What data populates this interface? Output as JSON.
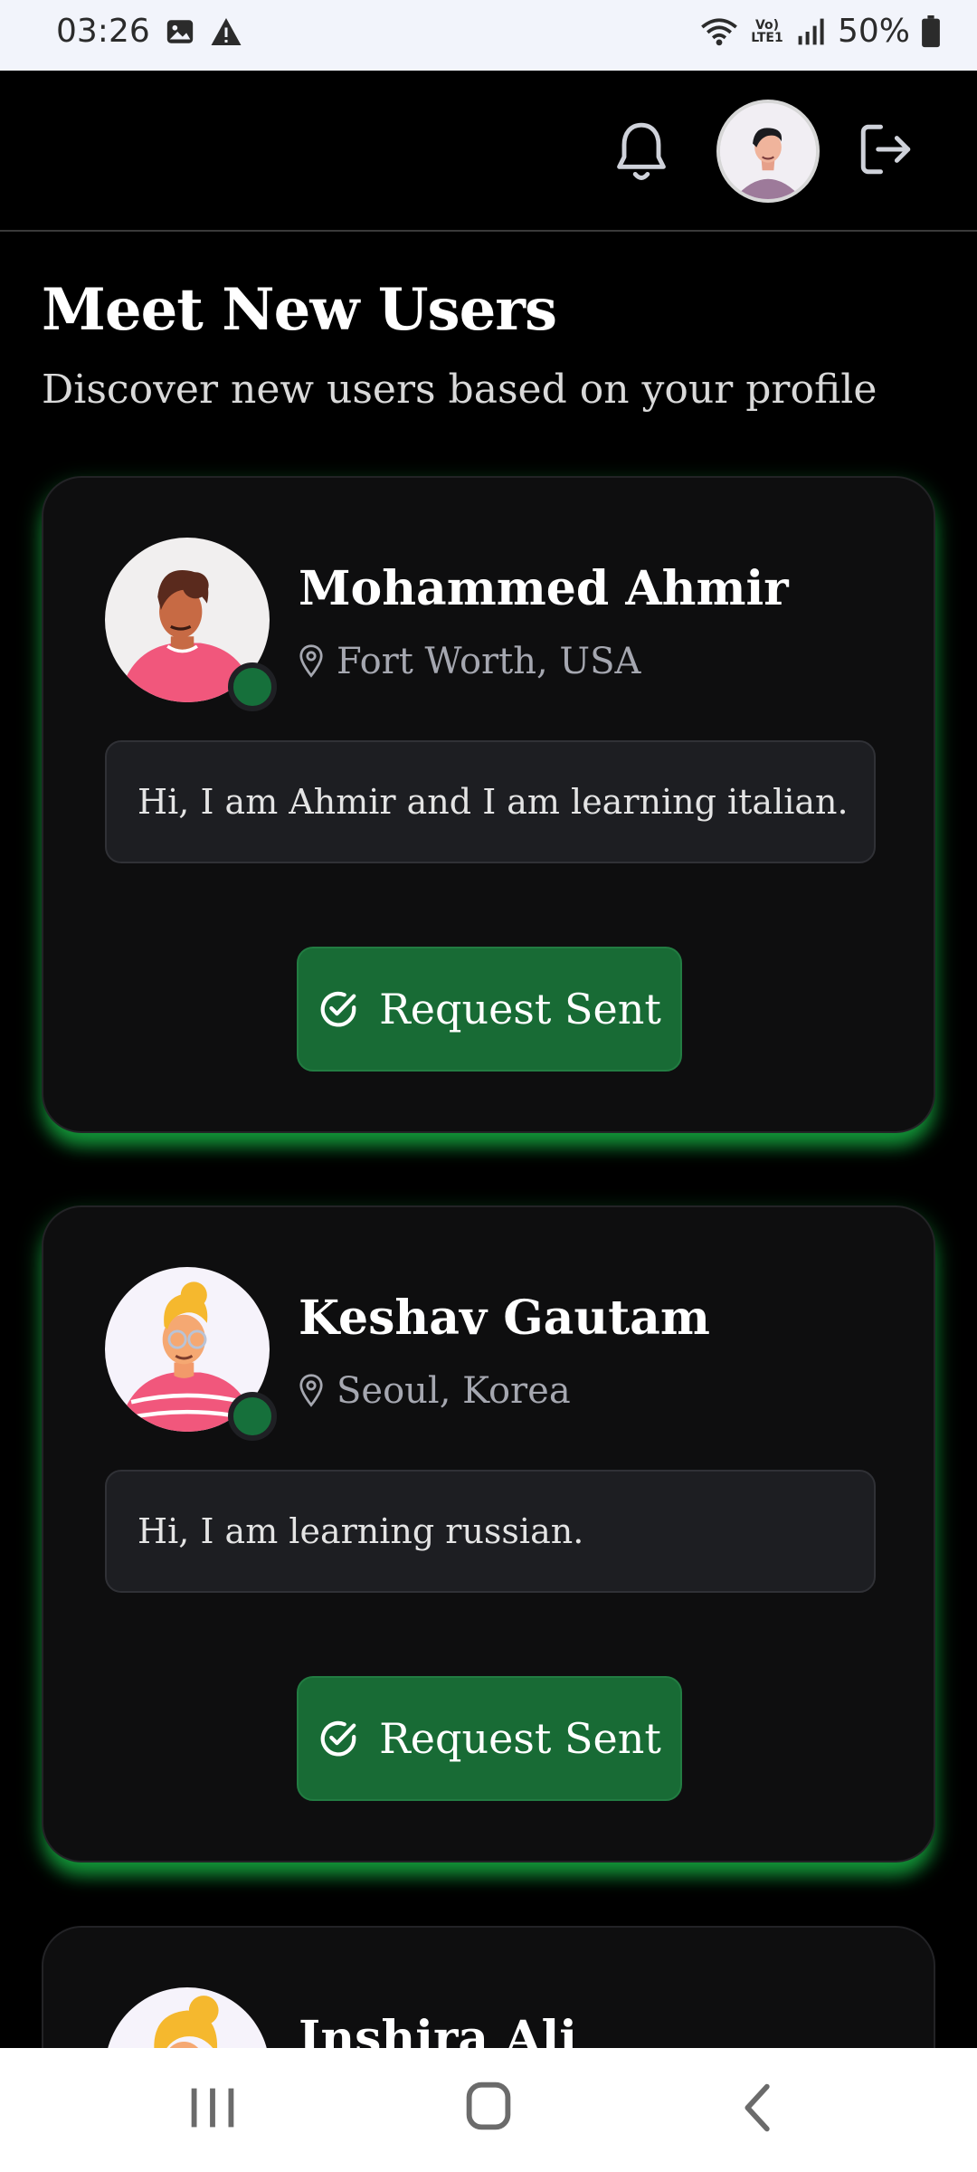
{
  "status_bar": {
    "time": "03:26",
    "network": "Vo) LTE1",
    "battery": "50%",
    "icons": [
      "image-icon",
      "warning-icon",
      "wifi-icon",
      "signal-icon",
      "battery-icon"
    ]
  },
  "header": {
    "icons": [
      "bell-icon",
      "user-avatar",
      "logout-icon"
    ]
  },
  "page": {
    "title": "Meet New Users",
    "subtitle": "Discover new users based on your profile"
  },
  "users": [
    {
      "name": "Mohammed Ahmir",
      "location": "Fort Worth, USA",
      "bio": "Hi, I am Ahmir and I am learning italian.",
      "button": "Request Sent"
    },
    {
      "name": "Keshav Gautam",
      "location": "Seoul, Korea",
      "bio": "Hi, I am learning russian.",
      "button": "Request Sent"
    },
    {
      "name": "Inshira Ali"
    }
  ],
  "colors": {
    "accent_green": "#186b35",
    "card_bg": "#0e0e0f",
    "glow": "#15aa3f"
  }
}
